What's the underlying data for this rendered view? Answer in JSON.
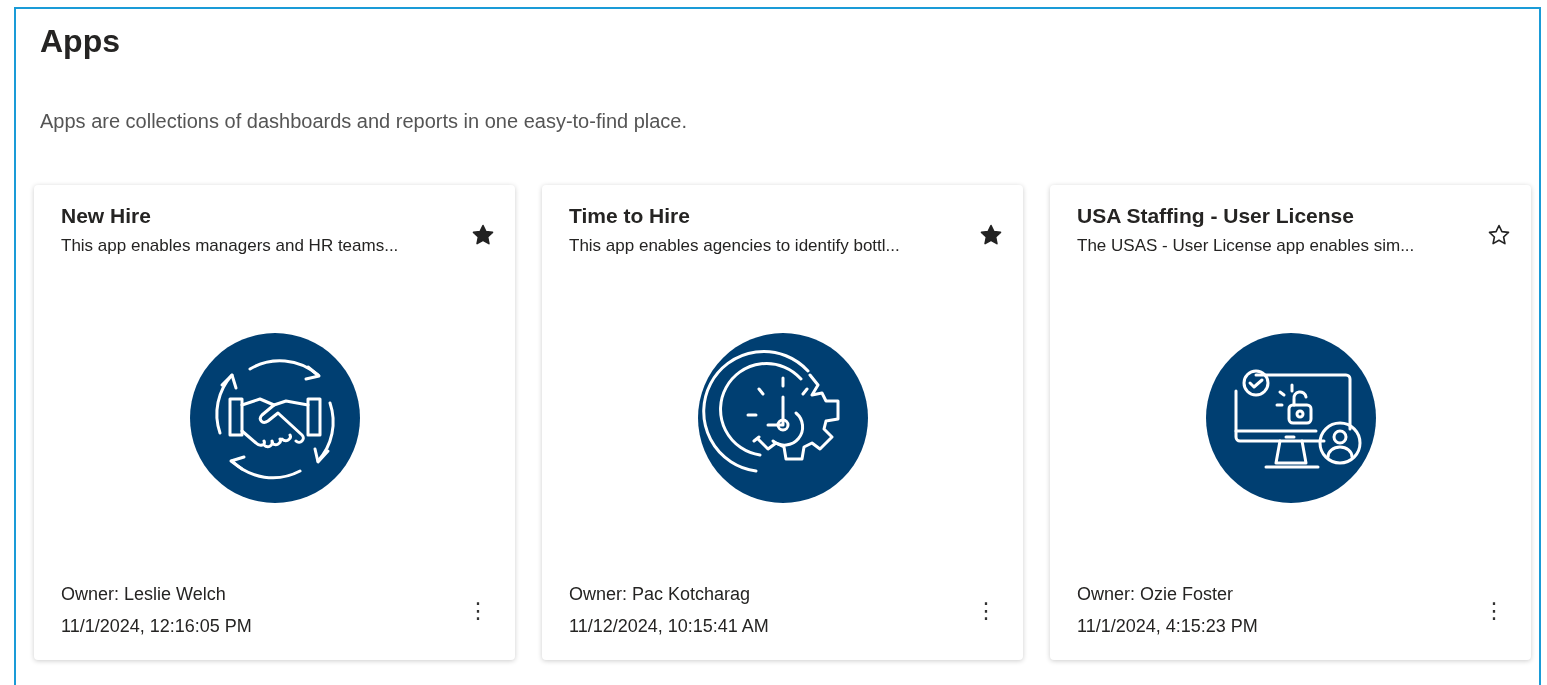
{
  "heading": "Apps",
  "subtitle": "Apps are collections of dashboards and reports in one easy-to-find place.",
  "apps": [
    {
      "title": "New Hire",
      "description": "This app enables managers and HR teams...",
      "favorite": true,
      "kind": "handshake",
      "owner": "Owner: Leslie Welch",
      "date": "11/1/2024, 12:16:05 PM",
      "more": "⋮"
    },
    {
      "title": "Time to Hire",
      "description": "This app enables agencies to identify bottl...",
      "favorite": true,
      "kind": "clock-gear",
      "owner": "Owner: Pac Kotcharag",
      "date": "11/12/2024, 10:15:41 AM",
      "more": "⋮"
    },
    {
      "title": "USA Staffing - User License",
      "description": "The USAS - User License app enables sim...",
      "favorite": false,
      "kind": "monitor-lock",
      "owner": "Owner: Ozie Foster",
      "date": "11/1/2024, 4:15:23 PM",
      "more": "⋮"
    }
  ]
}
